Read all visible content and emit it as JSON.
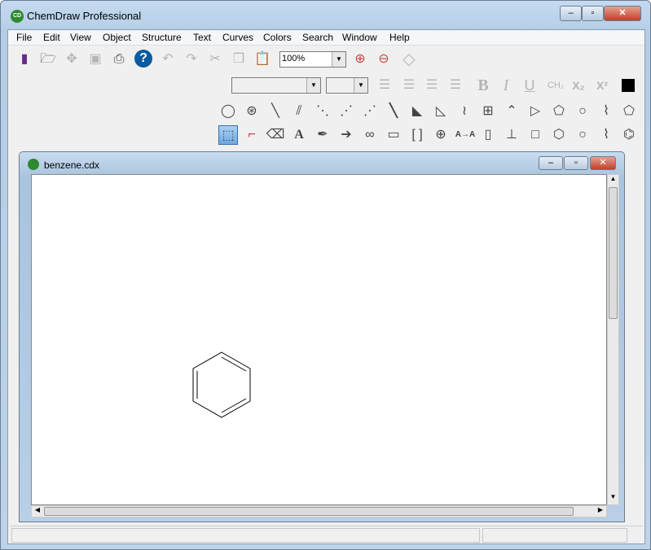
{
  "app": {
    "title": "ChemDraw Professional",
    "icon_label": "CD"
  },
  "menu": [
    "File",
    "Edit",
    "View",
    "Object",
    "Structure",
    "Text",
    "Curves",
    "Colors",
    "Search",
    "Window",
    "Help"
  ],
  "toolbar": {
    "zoom_value": "100%"
  },
  "text_toolbar": {
    "ch2": "CH₂",
    "sub": "X₂",
    "sup": "X²",
    "bold": "B",
    "italic": "I",
    "underline": "U"
  },
  "tools": {
    "text_tool": "A",
    "atom_map": "A→A"
  },
  "document": {
    "title": "benzene.cdx"
  },
  "colors": {
    "accent": "#1a5fb4"
  }
}
